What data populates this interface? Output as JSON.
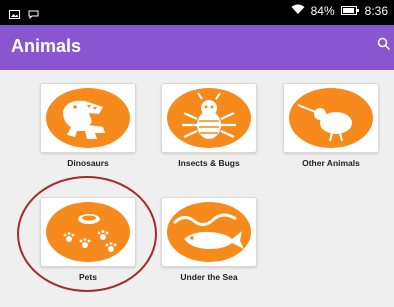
{
  "status_bar": {
    "battery": "84%",
    "time": "8:36",
    "icons": [
      "image-icon",
      "message-icon",
      "wifi-icon",
      "battery-icon"
    ]
  },
  "app_bar": {
    "title": "Animals",
    "icon": "search-icon",
    "color": "#8a56cf"
  },
  "categories": [
    {
      "label": "Dinosaurs",
      "icon": "dinosaur-icon"
    },
    {
      "label": "Insects & Bugs",
      "icon": "bug-icon"
    },
    {
      "label": "Other Animals",
      "icon": "kiwi-bird-icon"
    },
    {
      "label": "Pets",
      "icon": "pet-bowl-paws-icon"
    },
    {
      "label": "Under the Sea",
      "icon": "fish-waves-icon"
    }
  ],
  "colors": {
    "accent_orange": "#f78a1d",
    "highlight_ring": "#a42a2f"
  }
}
